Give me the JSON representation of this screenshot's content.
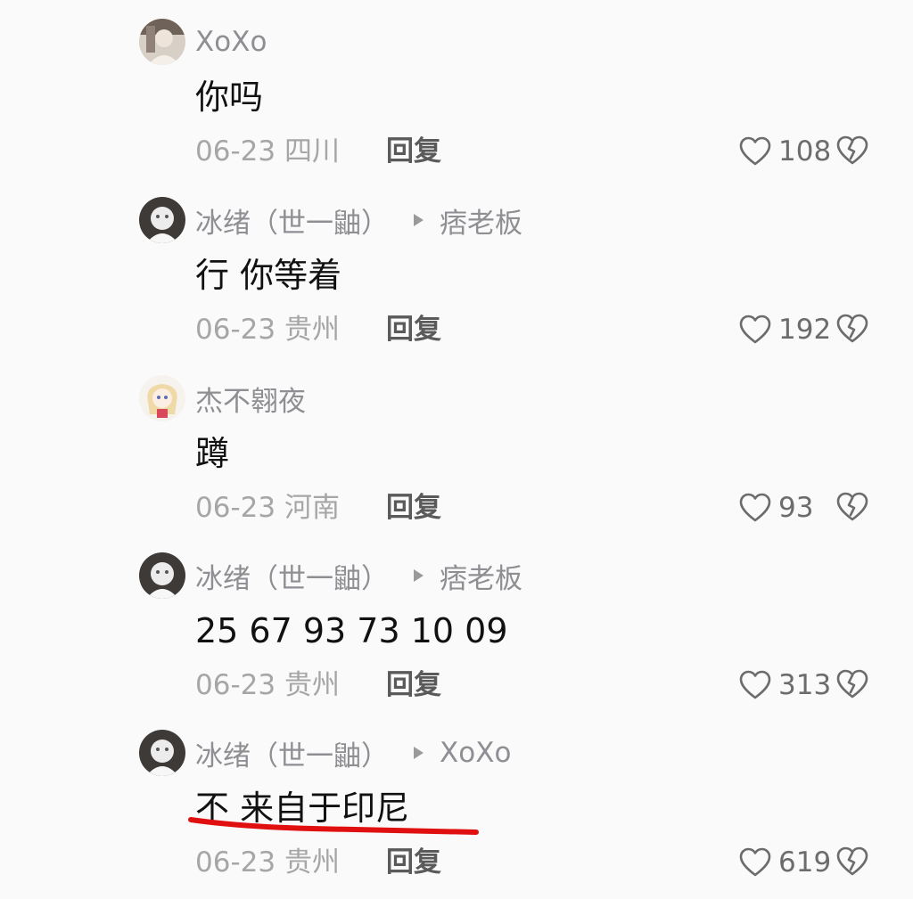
{
  "comments": [
    {
      "username": "XoXo",
      "reply_to": "",
      "text": "你吗",
      "date": "06-23",
      "location": "四川",
      "reply_label": "回复",
      "likes": "108"
    },
    {
      "username": "冰绪（世一鼬）",
      "reply_to": "痞老板",
      "text": "行 你等着",
      "date": "06-23",
      "location": "贵州",
      "reply_label": "回复",
      "likes": "192"
    },
    {
      "username": "杰不翱夜",
      "reply_to": "",
      "text": "蹲",
      "date": "06-23",
      "location": "河南",
      "reply_label": "回复",
      "likes": "93"
    },
    {
      "username": "冰绪（世一鼬）",
      "reply_to": "痞老板",
      "text": "25 67 93 73 10 09",
      "date": "06-23",
      "location": "贵州",
      "reply_label": "回复",
      "likes": "313"
    },
    {
      "username": "冰绪（世一鼬）",
      "reply_to": "XoXo",
      "text": "不 来自于印尼",
      "date": "06-23",
      "location": "贵州",
      "reply_label": "回复",
      "likes": "619"
    }
  ],
  "colors": {
    "background": "#fafafa",
    "username": "#8e8e93",
    "content": "#111111",
    "meta": "#a6a6a6",
    "reply": "#5a5a5a",
    "underline_annotation": "#e01010"
  },
  "icons": {
    "like": "heart-outline-icon",
    "dislike": "broken-heart-icon",
    "reply_indicator": "triangle-right-icon"
  }
}
